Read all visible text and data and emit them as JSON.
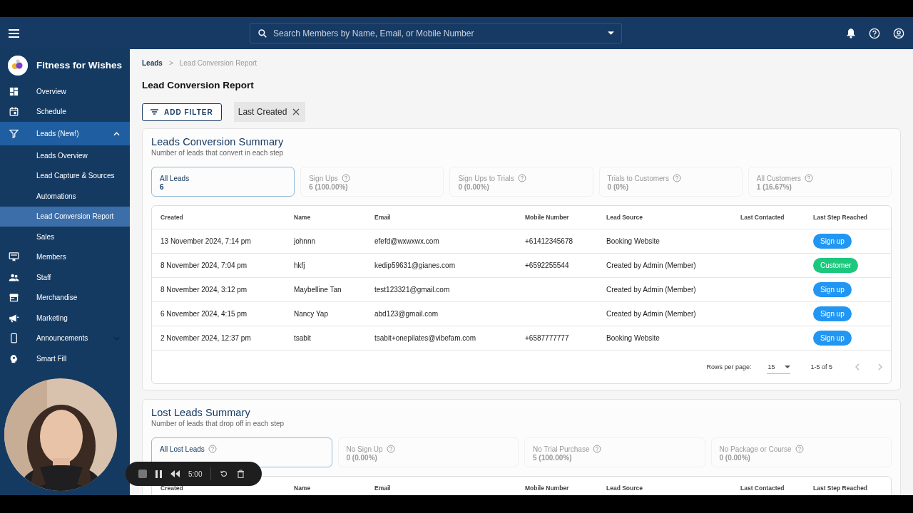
{
  "header": {
    "search": {
      "placeholder": "Search Members by Name, Email, or Mobile Number"
    }
  },
  "sidebar": {
    "brand": "Fitness for Wishes",
    "items": [
      {
        "label": "Overview",
        "selected": false
      },
      {
        "label": "Schedule",
        "selected": false
      },
      {
        "label": "Leads (New!)",
        "selected": true,
        "expanded": true,
        "children": [
          {
            "label": "Leads Overview",
            "selected": false
          },
          {
            "label": "Lead Capture & Sources",
            "selected": false
          },
          {
            "label": "Automations",
            "selected": false
          },
          {
            "label": "Lead Conversion Report",
            "selected": true
          },
          {
            "label": "Sales",
            "selected": false
          }
        ]
      },
      {
        "label": "Members",
        "selected": false
      },
      {
        "label": "Staff",
        "selected": false
      },
      {
        "label": "Merchandise",
        "selected": false
      },
      {
        "label": "Marketing",
        "selected": false
      },
      {
        "label": "Announcements",
        "selected": false,
        "expanded": false
      },
      {
        "label": "Smart Fill",
        "selected": false
      }
    ]
  },
  "breadcrumb": {
    "separator": ">",
    "items": [
      {
        "label": "Leads"
      },
      {
        "label": "Lead Conversion Report"
      }
    ]
  },
  "page_title": "Lead Conversion Report",
  "filters": {
    "add_button": "ADD FILTER",
    "chips": [
      {
        "label": "Last Created"
      }
    ]
  },
  "sections": [
    {
      "title": "Leads Conversion Summary",
      "subtitle": "Number of leads that convert in each step",
      "stats": [
        {
          "label": "All Leads",
          "value": "6",
          "selected": true,
          "help": false
        },
        {
          "label": "Sign Ups",
          "value": "6 (100.00%)",
          "selected": false,
          "help": true
        },
        {
          "label": "Sign Ups to Trials",
          "value": "0 (0.00%)",
          "selected": false,
          "help": true
        },
        {
          "label": "Trials to Customers",
          "value": "0 (0%)",
          "selected": false,
          "help": true
        },
        {
          "label": "All Customers",
          "value": "1 (16.67%)",
          "selected": false,
          "help": true
        }
      ],
      "columns": [
        "Created",
        "Name",
        "Email",
        "Mobile Number",
        "Lead Source",
        "Last Contacted",
        "Last Step Reached"
      ],
      "rows": [
        {
          "created": "13 November 2024, 7:14 pm",
          "name": "johnnn",
          "email": "efefd@wxwxwx.com",
          "mobile": "+61412345678",
          "source": "Booking Website",
          "step": {
            "label": "Sign up",
            "color": "#2196f3"
          }
        },
        {
          "created": "8 November 2024, 7:04 pm",
          "name": "hkfj",
          "email": "kedip59631@gianes.com",
          "mobile": "+6592255544",
          "source": "Created by Admin (Member)",
          "step": {
            "label": "Customer",
            "color": "#1dc77e"
          }
        },
        {
          "created": "8 November 2024, 3:12 pm",
          "name": "Maybelline Tan",
          "email": "test123321@gmail.com",
          "source": "Created by Admin (Member)",
          "step": {
            "label": "Sign up",
            "color": "#2196f3"
          }
        },
        {
          "created": "6 November 2024, 4:15 pm",
          "name": "Nancy Yap",
          "email": "abd123@gmail.com",
          "source": "Created by Admin (Member)",
          "step": {
            "label": "Sign up",
            "color": "#2196f3"
          }
        },
        {
          "created": "2 November 2024, 12:37 pm",
          "name": "tsabit",
          "email": "tsabit+onepilates@vibefam.com",
          "mobile": "+6587777777",
          "source": "Booking Website",
          "step": {
            "label": "Sign up",
            "color": "#2196f3"
          }
        }
      ],
      "pagination": {
        "rows_label": "Rows per page:",
        "rows_value": "15",
        "range": "1-5 of 5"
      }
    },
    {
      "title": "Lost Leads Summary",
      "subtitle": "Number of leads that drop off in each step",
      "stats": [
        {
          "label": "All Lost Leads",
          "selected": true,
          "help": true
        },
        {
          "label": "No Sign Up",
          "value": "0 (0.00%)",
          "selected": false,
          "help": true
        },
        {
          "label": "No Trial Purchase",
          "value": "5 (100.00%)",
          "selected": false,
          "help": true
        },
        {
          "label": "No Package or Course",
          "value": "0 (0.00%)",
          "selected": false,
          "help": true
        }
      ],
      "columns": [
        "Created",
        "Name",
        "Email",
        "Mobile Number",
        "Lead Source",
        "Last Contacted",
        "Last Step Reached"
      ]
    }
  ],
  "recorder": {
    "timer": "5:00"
  }
}
